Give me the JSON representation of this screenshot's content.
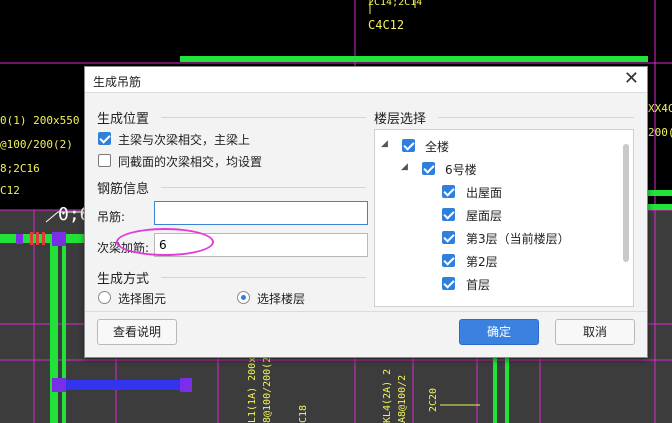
{
  "background_cad": {
    "texts": [
      "2C14;2C14",
      "C4C12",
      "0(1) 200x550",
      "@100/200(2)",
      "8;2C16",
      "C12",
      "0;6",
      "XX4C",
      "200(2",
      "L1(1A) 200x5",
      "8@100/200(2",
      "C18",
      "KL4(2A) 2",
      "A8@100/2",
      "2C20"
    ],
    "colors": {
      "line_green": "#22e23a",
      "magenta": "#d82ad0",
      "yellow": "#f2f25a",
      "blue_block": "#3434ee"
    }
  },
  "dialog": {
    "title": "生成吊筋",
    "close_glyph": "✕",
    "position_section": {
      "label": "生成位置",
      "options": [
        {
          "label": "主梁与次梁相交，主梁上",
          "checked": true
        },
        {
          "label": "同截面的次梁相交，均设置",
          "checked": false
        }
      ]
    },
    "rebar_section": {
      "label": "钢筋信息",
      "hanger_label": "吊筋:",
      "hanger_value": "",
      "secondary_label": "次梁加筋:",
      "secondary_value": "6"
    },
    "method_section": {
      "label": "生成方式",
      "options": [
        {
          "label": "选择图元",
          "selected": false
        },
        {
          "label": "选择楼层",
          "selected": true
        }
      ]
    },
    "floor_section": {
      "label": "楼层选择",
      "tree": [
        {
          "label": "全楼",
          "level": 0,
          "expanded": true,
          "checked": true
        },
        {
          "label": "6号楼",
          "level": 1,
          "expanded": true,
          "checked": true
        },
        {
          "label": "出屋面",
          "level": 2,
          "checked": true
        },
        {
          "label": "屋面层",
          "level": 2,
          "checked": true
        },
        {
          "label": "第3层（当前楼层）",
          "level": 2,
          "checked": true
        },
        {
          "label": "第2层",
          "level": 2,
          "checked": true
        },
        {
          "label": "首层",
          "level": 2,
          "checked": true
        }
      ]
    },
    "buttons": {
      "help": "查看说明",
      "ok": "确定",
      "cancel": "取消"
    },
    "accent_color": "#3b82e0"
  }
}
